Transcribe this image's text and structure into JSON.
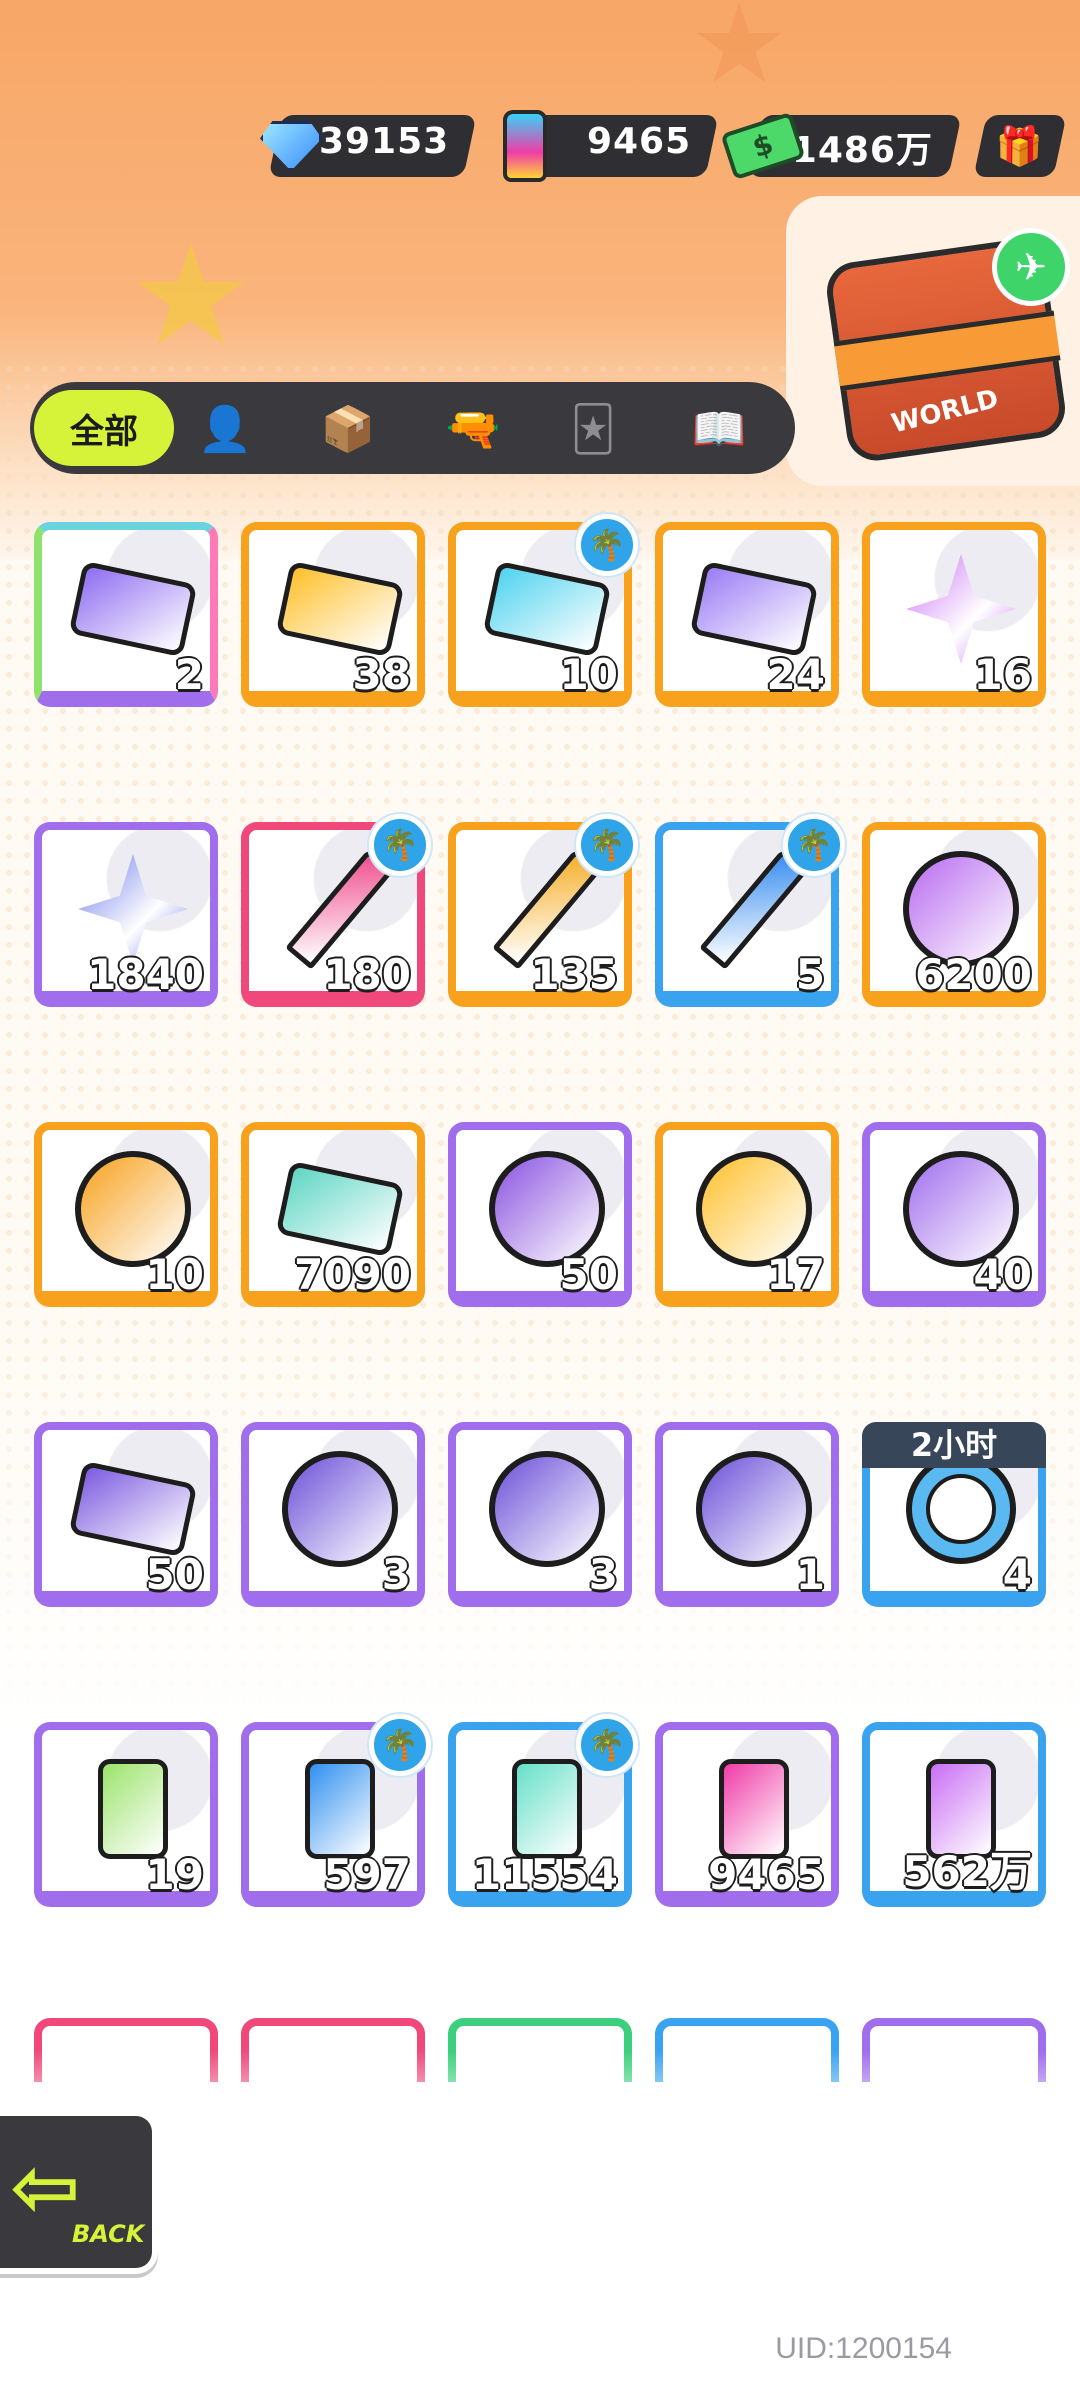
{
  "currencies": [
    {
      "name": "diamond",
      "icon": "diamond-icon",
      "value": "39153"
    },
    {
      "name": "spray",
      "icon": "spray-can-icon",
      "value": "9465"
    },
    {
      "name": "cash",
      "icon": "cash-icon",
      "value": "1486万"
    }
  ],
  "tabs": {
    "all_label": "全部",
    "icons": [
      "person-icon",
      "box-icon",
      "spray-gun-icon",
      "card-icon",
      "book-icon"
    ]
  },
  "featured": {
    "label": "WORLD"
  },
  "items": [
    {
      "count": "2",
      "border": "rainbow",
      "art": "ticket",
      "color": "#8e6df2",
      "tag": false
    },
    {
      "count": "38",
      "border": "orange",
      "art": "ticket",
      "color": "#ffc02a",
      "tag": false
    },
    {
      "count": "10",
      "border": "orange",
      "art": "ticket",
      "color": "#4fd3ef",
      "tag": true
    },
    {
      "count": "24",
      "border": "orange",
      "art": "ticket",
      "color": "#9a7cf5",
      "tag": false
    },
    {
      "count": "16",
      "border": "orange",
      "art": "star4",
      "color": "#c96ef5",
      "tag": false
    },
    {
      "count": "1840",
      "border": "purple",
      "art": "star4",
      "color": "#6b78ea",
      "tag": false
    },
    {
      "count": "180",
      "border": "pink",
      "art": "crayon",
      "color": "#f0508f",
      "tag": true
    },
    {
      "count": "135",
      "border": "orange",
      "art": "crayon",
      "color": "#f7b02d",
      "tag": true
    },
    {
      "count": "5",
      "border": "blue",
      "art": "crayon",
      "color": "#3a8ef0",
      "tag": true
    },
    {
      "count": "6200",
      "border": "orange",
      "art": "orb",
      "color": "#b86af0",
      "tag": false
    },
    {
      "count": "10",
      "border": "orange",
      "art": "orb",
      "color": "#f7a11d",
      "tag": false
    },
    {
      "count": "7090",
      "border": "orange",
      "art": "ticket",
      "color": "#5fd6c4",
      "tag": false
    },
    {
      "count": "50",
      "border": "purple",
      "art": "orb",
      "color": "#8a52e0",
      "tag": false
    },
    {
      "count": "17",
      "border": "orange",
      "art": "orb",
      "color": "#ffc02a",
      "tag": false
    },
    {
      "count": "40",
      "border": "purple",
      "art": "orb",
      "color": "#a06ded",
      "tag": false
    },
    {
      "count": "50",
      "border": "purple",
      "art": "ticket",
      "color": "#7c5be0",
      "tag": false
    },
    {
      "count": "3",
      "border": "purple",
      "art": "orb",
      "color": "#6a4fd8",
      "tag": false
    },
    {
      "count": "3",
      "border": "purple",
      "art": "orb",
      "color": "#6a4fd8",
      "tag": false
    },
    {
      "count": "1",
      "border": "purple",
      "art": "orb",
      "color": "#6a4fd8",
      "tag": false
    },
    {
      "count": "4",
      "border": "blue",
      "art": "clock",
      "color": "#5bb9f2",
      "tag": false,
      "timer": "2小时"
    },
    {
      "count": "19",
      "border": "purple",
      "art": "can",
      "color": "#9be36a",
      "tag": false
    },
    {
      "count": "597",
      "border": "purple",
      "art": "can",
      "color": "#2f8ff0",
      "tag": true
    },
    {
      "count": "11554",
      "border": "blue",
      "art": "can",
      "color": "#66e0c8",
      "tag": true
    },
    {
      "count": "9465",
      "border": "purple",
      "art": "can",
      "color": "#f03ca7",
      "tag": false
    },
    {
      "count": "562万",
      "border": "blue",
      "art": "can",
      "color": "#c96ef5",
      "tag": false
    }
  ],
  "partial_borders": [
    "#f0487b",
    "#f0487b",
    "#3ccf7d",
    "#3aa3f0",
    "#a06ded"
  ],
  "back": {
    "label": "BACK"
  },
  "uid": "UID:1200154"
}
